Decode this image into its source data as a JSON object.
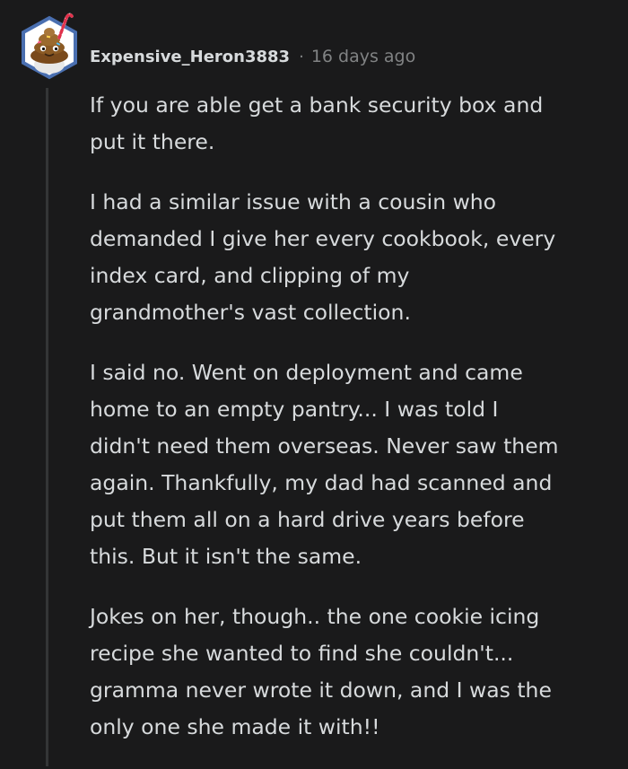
{
  "comment": {
    "username": "Expensive_Heron3883",
    "separator": "·",
    "timestamp": "16 days ago",
    "paragraphs": [
      {
        "lines": [
          "If you are able get a bank security box and",
          "put it there."
        ]
      },
      {
        "lines": [
          "I had a similar issue with a cousin who",
          "demanded I give her every cookbook, every",
          "index card, and clipping of my",
          "grandmother's vast collection."
        ]
      },
      {
        "lines": [
          "I said no. Went on deployment and came",
          "home to an empty pantry... I was told I",
          "didn't need them overseas. Never saw them",
          "again. Thankfully, my dad had scanned and",
          "put them all on a hard drive years before",
          "this. But it isn't the same."
        ]
      },
      {
        "lines": [
          "Jokes on her, though.. the one cookie icing",
          "recipe she wanted to find she couldn't...",
          "gramma never wrote it down, and I was the",
          "only one she made it with!!"
        ]
      }
    ]
  },
  "icons": {
    "avatar": "snoo-avatar-icon"
  },
  "colors": {
    "background": "#1a1a1b",
    "text": "#d7dadc",
    "meta": "#818384",
    "thread_line": "#343536",
    "avatar_frame": "#4a6fb0"
  }
}
